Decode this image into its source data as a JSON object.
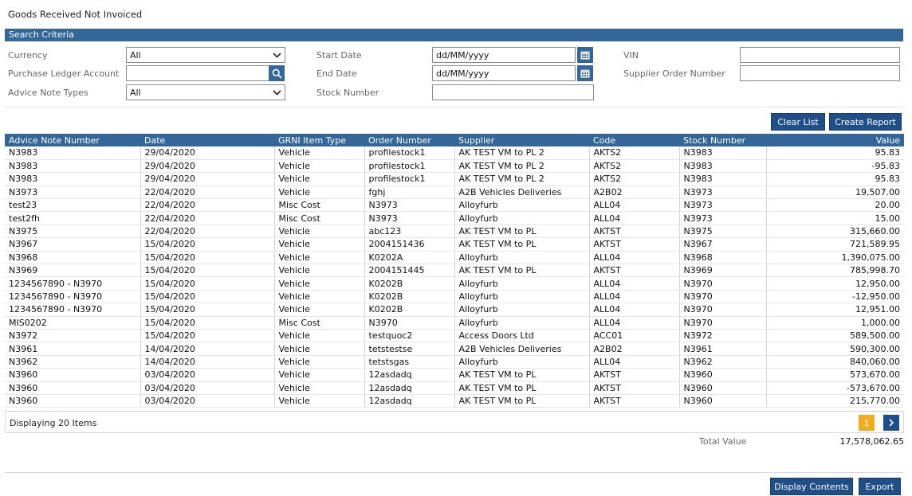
{
  "page": {
    "title": "Goods Received Not Invoiced"
  },
  "search": {
    "section_title": "Search Criteria",
    "currency_label": "Currency",
    "currency_value": "All",
    "purchase_ledger_label": "Purchase Ledger Account",
    "purchase_ledger_value": "",
    "advice_note_types_label": "Advice Note Types",
    "advice_note_types_value": "All",
    "start_date_label": "Start Date",
    "start_date_value": "dd/MM/yyyy",
    "end_date_label": "End Date",
    "end_date_value": "dd/MM/yyyy",
    "stock_number_label": "Stock Number",
    "stock_number_value": "",
    "vin_label": "VIN",
    "vin_value": "",
    "supplier_order_label": "Supplier Order Number",
    "supplier_order_value": ""
  },
  "actions": {
    "clear_list": "Clear List",
    "create_report": "Create Report"
  },
  "table": {
    "columns": [
      "Advice Note Number",
      "Date",
      "GRNI Item Type",
      "Order Number",
      "Supplier",
      "Code",
      "Stock Number",
      "Value"
    ],
    "rows": [
      [
        "N3983",
        "29/04/2020",
        "Vehicle",
        "profilestock1",
        "AK TEST VM to PL 2",
        "AKTS2",
        "N3983",
        "95.83"
      ],
      [
        "N3983",
        "29/04/2020",
        "Vehicle",
        "profilestock1",
        "AK TEST VM to PL 2",
        "AKTS2",
        "N3983",
        "-95.83"
      ],
      [
        "N3983",
        "29/04/2020",
        "Vehicle",
        "profilestock1",
        "AK TEST VM to PL 2",
        "AKTS2",
        "N3983",
        "95.83"
      ],
      [
        "N3973",
        "22/04/2020",
        "Vehicle",
        "fghj",
        "A2B Vehicles Deliveries",
        "A2B02",
        "N3973",
        "19,507.00"
      ],
      [
        "test23",
        "22/04/2020",
        "Misc Cost",
        "N3973",
        "Alloyfurb",
        "ALL04",
        "N3973",
        "20.00"
      ],
      [
        "test2fh",
        "22/04/2020",
        "Misc Cost",
        "N3973",
        "Alloyfurb",
        "ALL04",
        "N3973",
        "15.00"
      ],
      [
        "N3975",
        "22/04/2020",
        "Vehicle",
        "abc123",
        "AK TEST VM to PL",
        "AKTST",
        "N3975",
        "315,660.00"
      ],
      [
        "N3967",
        "15/04/2020",
        "Vehicle",
        "2004151436",
        "AK TEST VM to PL",
        "AKTST",
        "N3967",
        "721,589.95"
      ],
      [
        "N3968",
        "15/04/2020",
        "Vehicle",
        "K0202A",
        "Alloyfurb",
        "ALL04",
        "N3968",
        "1,390,075.00"
      ],
      [
        "N3969",
        "15/04/2020",
        "Vehicle",
        "2004151445",
        "AK TEST VM to PL",
        "AKTST",
        "N3969",
        "785,998.70"
      ],
      [
        "1234567890 - N3970",
        "15/04/2020",
        "Vehicle",
        "K0202B",
        "Alloyfurb",
        "ALL04",
        "N3970",
        "12,950.00"
      ],
      [
        "1234567890 - N3970",
        "15/04/2020",
        "Vehicle",
        "K0202B",
        "Alloyfurb",
        "ALL04",
        "N3970",
        "-12,950.00"
      ],
      [
        "1234567890 - N3970",
        "15/04/2020",
        "Vehicle",
        "K0202B",
        "Alloyfurb",
        "ALL04",
        "N3970",
        "12,951.00"
      ],
      [
        "MIS0202",
        "15/04/2020",
        "Misc Cost",
        "N3970",
        "Alloyfurb",
        "ALL04",
        "N3970",
        "1,000.00"
      ],
      [
        "N3972",
        "15/04/2020",
        "Vehicle",
        "testquoc2",
        "Access Doors Ltd",
        "ACC01",
        "N3972",
        "589,500.00"
      ],
      [
        "N3961",
        "14/04/2020",
        "Vehicle",
        "tetstestse",
        "A2B Vehicles Deliveries",
        "A2B02",
        "N3961",
        "590,300.00"
      ],
      [
        "N3962",
        "14/04/2020",
        "Vehicle",
        "tetstsgas",
        "Alloyfurb",
        "ALL04",
        "N3962",
        "840,060.00"
      ],
      [
        "N3960",
        "03/04/2020",
        "Vehicle",
        "12asdadq",
        "AK TEST VM to PL",
        "AKTST",
        "N3960",
        "573,670.00"
      ],
      [
        "N3960",
        "03/04/2020",
        "Vehicle",
        "12asdadq",
        "AK TEST VM to PL",
        "AKTST",
        "N3960",
        "-573,670.00"
      ],
      [
        "N3960",
        "03/04/2020",
        "Vehicle",
        "12asdadq",
        "AK TEST VM to PL",
        "AKTST",
        "N3960",
        "215,770.00"
      ]
    ]
  },
  "footer": {
    "item_count": "Displaying 20 Items",
    "current_page": "1",
    "next_icon": "chevron-right-icon",
    "total_label": "Total Value",
    "total_value": "17,578,062.65",
    "display_contents": "Display Contents",
    "export": "Export"
  },
  "colors": {
    "header_blue": "#336699",
    "button_blue": "#1f4e88",
    "page_active": "#f0ad1e"
  }
}
